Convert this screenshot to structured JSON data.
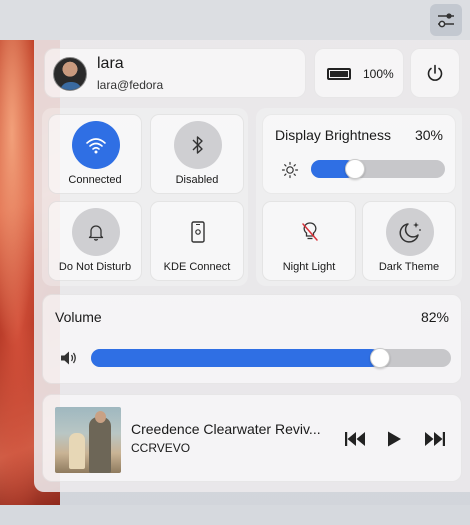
{
  "topbar": {
    "settings_icon": "sliders-icon"
  },
  "user": {
    "name": "lara",
    "handle": "lara@fedora"
  },
  "battery": {
    "icon": "battery-icon",
    "percent": "100%"
  },
  "power": {
    "icon": "power-icon"
  },
  "quick_tiles": [
    {
      "label": "Connected",
      "icon": "wifi-icon",
      "active": true
    },
    {
      "label": "Disabled",
      "icon": "bluetooth-icon",
      "active": false
    },
    {
      "label": "Do Not Disturb",
      "icon": "bell-icon",
      "active": false
    },
    {
      "label": "KDE Connect",
      "icon": "phone-icon",
      "active": false
    }
  ],
  "brightness": {
    "title": "Display Brightness",
    "value": "30%",
    "level": 0.3,
    "icon": "sun-icon"
  },
  "toggles": [
    {
      "label": "Night Light",
      "icon": "lightbulb-off-icon"
    },
    {
      "label": "Dark Theme",
      "icon": "moon-stars-icon"
    }
  ],
  "volume": {
    "title": "Volume",
    "value": "82%",
    "level": 0.82,
    "icon": "speaker-icon"
  },
  "media": {
    "title": "Creedence Clearwater Reviv...",
    "artist": "CCRVEVO",
    "controls": [
      "previous-icon",
      "play-icon",
      "next-icon"
    ]
  },
  "colors": {
    "accent": "#2f6fe4",
    "panel": "#ece9ec",
    "wallpaper": "#c4432a"
  }
}
